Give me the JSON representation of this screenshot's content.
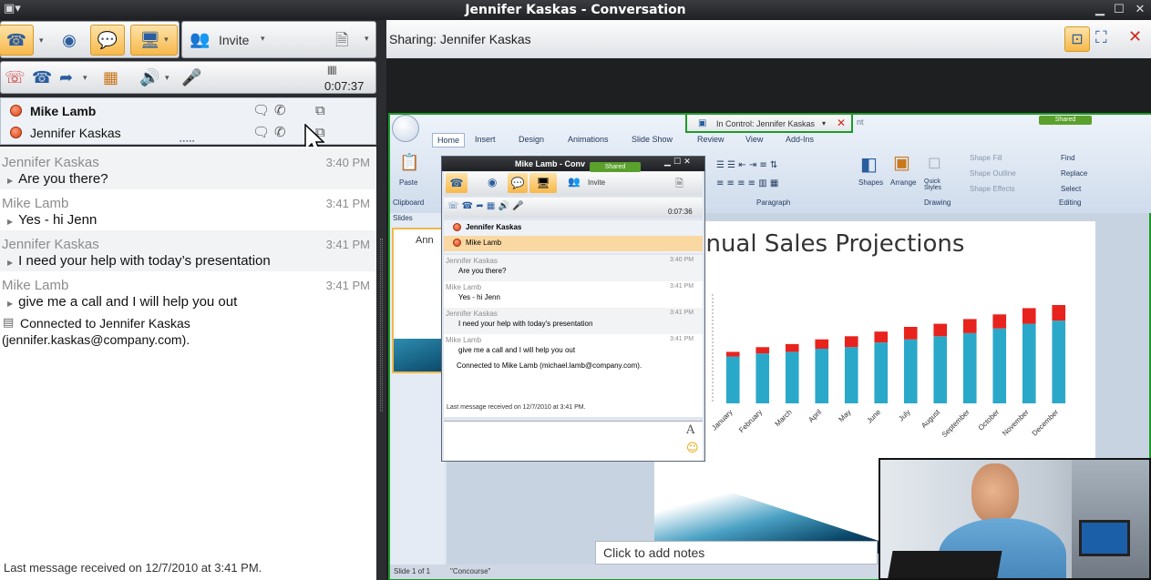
{
  "window": {
    "title": "Jennifer Kaskas - Conversation"
  },
  "toolbar": {
    "invite_label": "Invite",
    "call_timer": "0:07:37"
  },
  "participants": [
    {
      "name": "Mike Lamb",
      "bold": true
    },
    {
      "name": "Jennifer Kaskas",
      "bold": false
    }
  ],
  "messages": [
    {
      "sender": "Jennifer Kaskas",
      "time": "3:40 PM",
      "text": "Are you there?"
    },
    {
      "sender": "Mike Lamb",
      "time": "3:41 PM",
      "text": "Yes - hi Jenn"
    },
    {
      "sender": "Jennifer Kaskas",
      "time": "3:41 PM",
      "text": "I need your help with today’s presentation"
    },
    {
      "sender": "Mike Lamb",
      "time": "3:41 PM",
      "text": "give me a call and I will help you  out"
    }
  ],
  "connected": {
    "line1": "Connected to Jennifer Kaskas",
    "line2": "(jennifer.kaskas@company.com)."
  },
  "status": {
    "last_message": "Last message received on 12/7/2010 at 3:41 PM."
  },
  "sharing": {
    "label": "Sharing: Jennifer Kaskas",
    "in_control": "In Control: Jennifer Kaskas"
  },
  "ppt": {
    "tabs": [
      "Home",
      "Insert",
      "Design",
      "Animations",
      "Slide Show",
      "Review",
      "View",
      "Add-Ins"
    ],
    "groups": {
      "clipboard": "Clipboard",
      "paragraph": "Paragraph",
      "drawing": "Drawing",
      "editing": "Editing"
    },
    "paste": "Paste",
    "drawing_items": [
      "Shapes",
      "Arrange",
      "Quick Styles",
      "Shape Fill",
      "Shape Outline",
      "Shape Effects"
    ],
    "editing_items": [
      "Find",
      "Replace",
      "Select"
    ],
    "slides_tab": "Slides",
    "slide_title": "nnual Sales Projections",
    "thumb_title": "Ann",
    "notes_placeholder": "Click to add notes",
    "status_slide": "Slide 1 of 1",
    "status_theme": "\"Concourse\"",
    "tab_label_left": "nt",
    "shared_tag": "Shared"
  },
  "mini_window": {
    "title": "Mike Lamb - Conv",
    "shared_tag": "Shared",
    "invite_label": "Invite",
    "timer": "0:07:36",
    "participants": [
      "Jennifer Kaskas",
      "Mike Lamb"
    ],
    "messages": [
      {
        "sender": "Jennifer Kaskas",
        "time": "3:40 PM",
        "text": "Are you there?"
      },
      {
        "sender": "Mike Lamb",
        "time": "3:41 PM",
        "text": "Yes - hi Jenn"
      },
      {
        "sender": "Jennifer Kaskas",
        "time": "3:41 PM",
        "text": "I need your help with today's presentation"
      },
      {
        "sender": "Mike Lamb",
        "time": "3:41 PM",
        "text": "give me a call and I will help you  out"
      }
    ],
    "connected": "Connected to Mike Lamb (michael.lamb@company.com).",
    "last_message": "Last message received on 12/7/2010 at 3:41 PM.",
    "font_button": "A"
  },
  "chart_data": {
    "type": "bar",
    "title": "Annual Sales Projections",
    "categories": [
      "January",
      "February",
      "March",
      "April",
      "May",
      "June",
      "July",
      "August",
      "September",
      "October",
      "November",
      "December"
    ],
    "series": [
      {
        "values": [
          3.0,
          3.2,
          3.3,
          3.5,
          3.6,
          3.9,
          4.1,
          4.3,
          4.5,
          4.8,
          5.1,
          5.3
        ]
      },
      {
        "values": [
          0.3,
          0.4,
          0.5,
          0.6,
          0.7,
          0.7,
          0.8,
          0.8,
          0.9,
          0.9,
          1.0,
          1.0
        ]
      }
    ],
    "colors": [
      "#2aa8c9",
      "#e8231e"
    ],
    "ylim": [
      0,
      7
    ],
    "grid": false
  },
  "colors": {
    "accent_orange": "#f7b84a",
    "share_border": "#1d9a2a",
    "presence_busy": "#d2400f"
  }
}
